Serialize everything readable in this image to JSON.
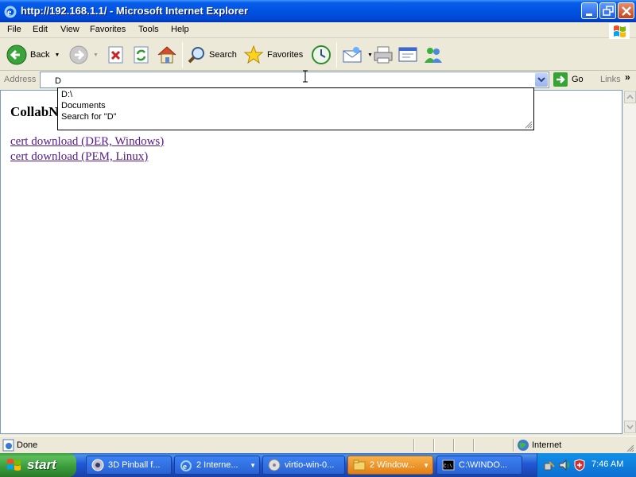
{
  "window": {
    "title": "http://192.168.1.1/ - Microsoft Internet Explorer"
  },
  "menu": [
    "File",
    "Edit",
    "View",
    "Favorites",
    "Tools",
    "Help"
  ],
  "toolbar": {
    "back_label": "Back",
    "search_label": "Search",
    "favorites_label": "Favorites"
  },
  "address": {
    "label": "Address",
    "value": "D",
    "go_label": "Go",
    "links_label": "Links"
  },
  "autocomplete": {
    "items": [
      "D:\\",
      "Documents",
      "Search for \"D\""
    ]
  },
  "page": {
    "heading": "CollabN",
    "links": [
      "cert download (DER, Windows)",
      "cert download (PEM, Linux)"
    ]
  },
  "status": {
    "text": "Done",
    "zone": "Internet"
  },
  "taskbar": {
    "start_label": "start",
    "tasks": [
      "3D Pinball f...",
      "2 Interne...",
      "virtio-win-0...",
      "2 Window...",
      "C:\\WINDO..."
    ],
    "clock": "7:46 AM"
  },
  "colors": {
    "titlebar": "#0055e5",
    "visited_link": "#551a8b",
    "taskbar": "#2157d7",
    "start": "#3a9a3a"
  }
}
